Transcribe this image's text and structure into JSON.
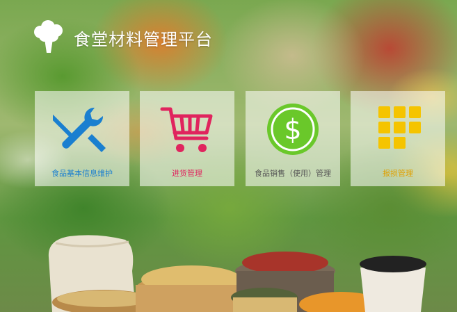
{
  "header": {
    "title": "食堂材料管理平台",
    "logo_icon": "broccoli-icon"
  },
  "tiles": [
    {
      "label": "食品基本信息维护",
      "icon": "wrench-screwdriver-icon",
      "color": "#1a7fd0"
    },
    {
      "label": "进货管理",
      "icon": "shopping-cart-icon",
      "color": "#e0245e"
    },
    {
      "label": "食品销售（使用）管理",
      "icon": "dollar-coin-icon",
      "color": "#6ac82a"
    },
    {
      "label": "报损管理",
      "icon": "grid-apps-icon",
      "color": "#f5c400"
    }
  ]
}
